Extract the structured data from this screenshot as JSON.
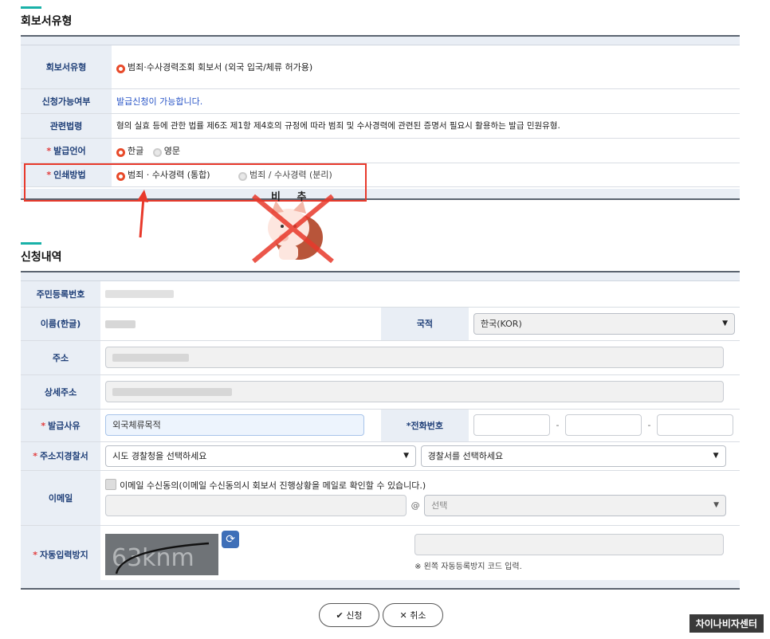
{
  "section1": {
    "title": "회보서유형",
    "rows": {
      "type_label": "회보서유형",
      "type_value": "범죄·수사경력조회 회보서 (외국 입국/체류 허가용)",
      "avail_label": "신청가능여부",
      "avail_value": "발급신청이 가능합니다.",
      "law_label": "관련법령",
      "law_value": "형의 실효 등에 관한 법률 제6조 제1항 제4호의 규정에 따라 범죄 및 수사경력에 관련된 증명서 필요시 활용하는 발급 민원유형.",
      "lang_label": "발급언어",
      "lang_options": [
        "한글",
        "영문"
      ],
      "print_label": "인쇄방법",
      "print_options": [
        "범죄 · 수사경력 (통합)",
        "범죄 / 수사경력 (분리)"
      ]
    },
    "required_mark": "*"
  },
  "annotation": {
    "text": "비 추"
  },
  "section2": {
    "title": "신청내역",
    "resident_label": "주민등록번호",
    "name_label": "이름(한글)",
    "nationality_label": "국적",
    "nationality_value": "한국(KOR)",
    "address_label": "주소",
    "detail_address_label": "상세주소",
    "reason_label": "발급사유",
    "reason_value": "외국체류목적",
    "phone_label": "전화번호",
    "phone_sep": "-",
    "police_label": "주소지경찰서",
    "police_select1": "시도 경찰청을 선택하세요",
    "police_select2": "경찰서를 선택하세요",
    "email_label": "이메일",
    "email_consent": "이메일 수신동의(이메일 수신동의시 회보서 진행상황을 메일로 확인할 수 있습니다.)",
    "email_at": "@",
    "email_domain_select": "선택",
    "captcha_label": "자동입력방지",
    "captcha_text": "63knm",
    "captcha_hint": "※ 왼쪽 자동등록방지 코드 입력."
  },
  "buttons": {
    "apply": "신청",
    "cancel": "취소"
  },
  "watermark": "차이나비자센터",
  "colors": {
    "accent": "#19b1a8",
    "label_bg": "#e9eef5",
    "label_text": "#1f3f78",
    "required": "#e23c3c",
    "highlight_box": "#e8392b"
  },
  "icons": [
    "radio-icon",
    "refresh-icon",
    "check-icon",
    "close-icon",
    "dropdown-arrow-icon",
    "red-arrow-icon",
    "cat-sticker"
  ]
}
